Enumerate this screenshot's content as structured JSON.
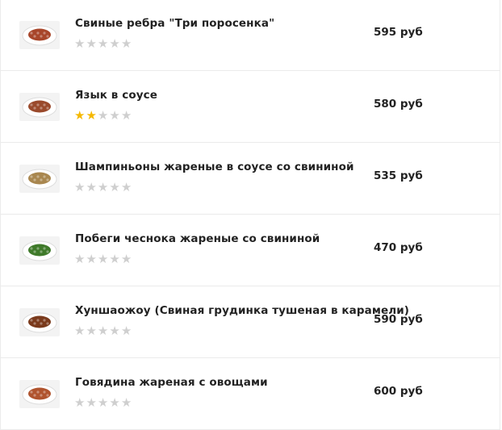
{
  "currency": "руб",
  "items": [
    {
      "name": "Свиные ребра \"Три поросенка\"",
      "price": "595 руб",
      "rating": 0,
      "max_rating": 5,
      "thumb_icon": "dish-ribs-icon",
      "thumb_color": "#a8462a"
    },
    {
      "name": "Язык в соусе",
      "price": "580 руб",
      "rating": 2,
      "max_rating": 5,
      "thumb_icon": "dish-tongue-icon",
      "thumb_color": "#9a4a2c"
    },
    {
      "name": "Шампиньоны жареные в соусе со свининой",
      "price": "535 руб",
      "rating": 0,
      "max_rating": 5,
      "thumb_icon": "dish-mushrooms-icon",
      "thumb_color": "#a9874f"
    },
    {
      "name": "Побеги чеснока жареные со свининой",
      "price": "470 руб",
      "rating": 0,
      "max_rating": 5,
      "thumb_icon": "dish-garlic-shoots-icon",
      "thumb_color": "#3f7a2a"
    },
    {
      "name": "Хуншаожоу (Свиная грудинка тушеная в карамели)",
      "price": "590 руб",
      "rating": 0,
      "max_rating": 5,
      "thumb_icon": "dish-pork-belly-icon",
      "thumb_color": "#7a3a1c"
    },
    {
      "name": "Говядина жареная с овощами",
      "price": "600 руб",
      "rating": 0,
      "max_rating": 5,
      "thumb_icon": "dish-beef-vegetables-icon",
      "thumb_color": "#b0542e"
    }
  ],
  "star_glyph": "★",
  "colors": {
    "star_on": "#f5b800",
    "star_off": "#cfcfcf",
    "divider": "#ebebeb"
  }
}
